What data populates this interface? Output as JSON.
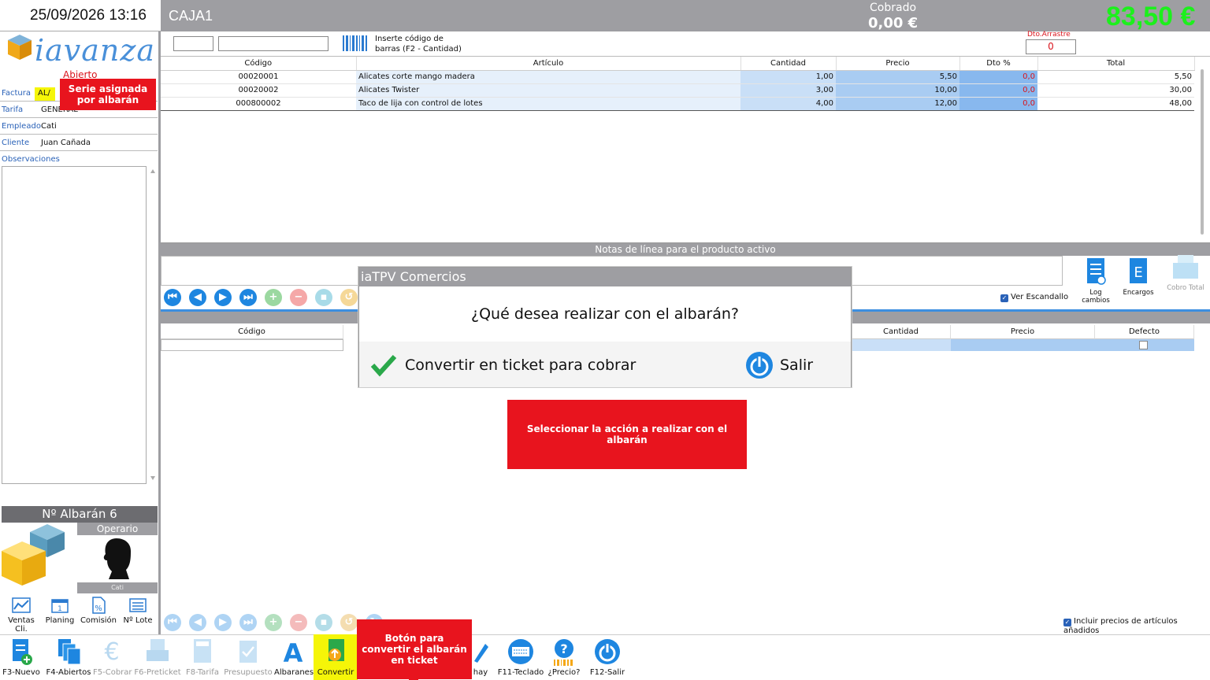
{
  "header": {
    "datetime": "25/09/2026 13:16",
    "caja": "CAJA1",
    "cobrado_label": "Cobrado",
    "cobrado_value": "0,00 €",
    "total_value": "83,50 €"
  },
  "left": {
    "logo_text": "iavanza",
    "status": "Abierto",
    "fields": {
      "factura_label": "Factura",
      "factura_serie": "AL/",
      "tarifa_label": "Tarifa",
      "tarifa_value": "GENERAL",
      "empleado_label": "Empleado",
      "empleado_value": "Cati",
      "cliente_label": "Cliente",
      "cliente_value": "Juan Cañada",
      "observaciones_label": "Observaciones"
    },
    "callout_serie": "Serie asignada por albarán",
    "albaran_label": "Nº Albarán 6",
    "operario_label": "Operario",
    "operario_name": "Cati",
    "tools": [
      "Ventas Cli.",
      "Planing",
      "Comisión",
      "Nº Lote"
    ]
  },
  "input_area": {
    "barcode_hint": "Inserte código de barras (F2 - Cantidad)",
    "dto_label": "Dto.Arrastre",
    "dto_value": "0"
  },
  "grid": {
    "headers": [
      "Código",
      "Artículo",
      "Cantidad",
      "Precio",
      "Dto %",
      "Total"
    ],
    "rows": [
      {
        "codigo": "00020001",
        "articulo": "Alicates corte mango madera",
        "cantidad": "1,00",
        "precio": "5,50",
        "dto": "0,0",
        "total": "5,50"
      },
      {
        "codigo": "00020002",
        "articulo": "Alicates Twister",
        "cantidad": "3,00",
        "precio": "10,00",
        "dto": "0,0",
        "total": "30,00"
      },
      {
        "codigo": "000800002",
        "articulo": "Taco de lija con control de lotes",
        "cantidad": "4,00",
        "precio": "12,00",
        "dto": "0,0",
        "total": "48,00"
      }
    ]
  },
  "notes_bar": "Notas de línea para el producto activo",
  "ver_escandallo": "Ver Escandallo",
  "side_icons": {
    "log": "Log cambios",
    "encargos": "Encargos",
    "cobro": "Cobro Total"
  },
  "grid2": {
    "headers": [
      "Código",
      "Cantidad",
      "Precio",
      "Defecto"
    ]
  },
  "incluir_precios": "Incluir precios de artículos añadidos",
  "toolbar": {
    "items": [
      {
        "label": "F3-Nuevo"
      },
      {
        "label": "F4-Abiertos"
      },
      {
        "label": "F5-Cobrar"
      },
      {
        "label": "F6-Preticket"
      },
      {
        "label": "F8-Tarifa"
      },
      {
        "label": "Presupuesto"
      },
      {
        "label": "Albaranes"
      },
      {
        "label": "Convertir"
      },
      {
        "label": "hay"
      },
      {
        "label": "F11-Teclado"
      },
      {
        "label": "¿Precio?"
      },
      {
        "label": "F12-Salir"
      }
    ],
    "callout": "Botón para convertir el albarán en ticket"
  },
  "dialog": {
    "title": "iaTPV Comercios",
    "message": "¿Qué desea realizar con el albarán?",
    "convert_label": "Convertir en ticket para cobrar",
    "exit_label": "Salir"
  },
  "banner": "Seleccionar la acción a realizar con el albarán",
  "colors": {
    "accent_blue": "#2a62b8",
    "total_green": "#1cf01c",
    "callout_red": "#e8141e",
    "header_gray": "#9e9ea2"
  }
}
